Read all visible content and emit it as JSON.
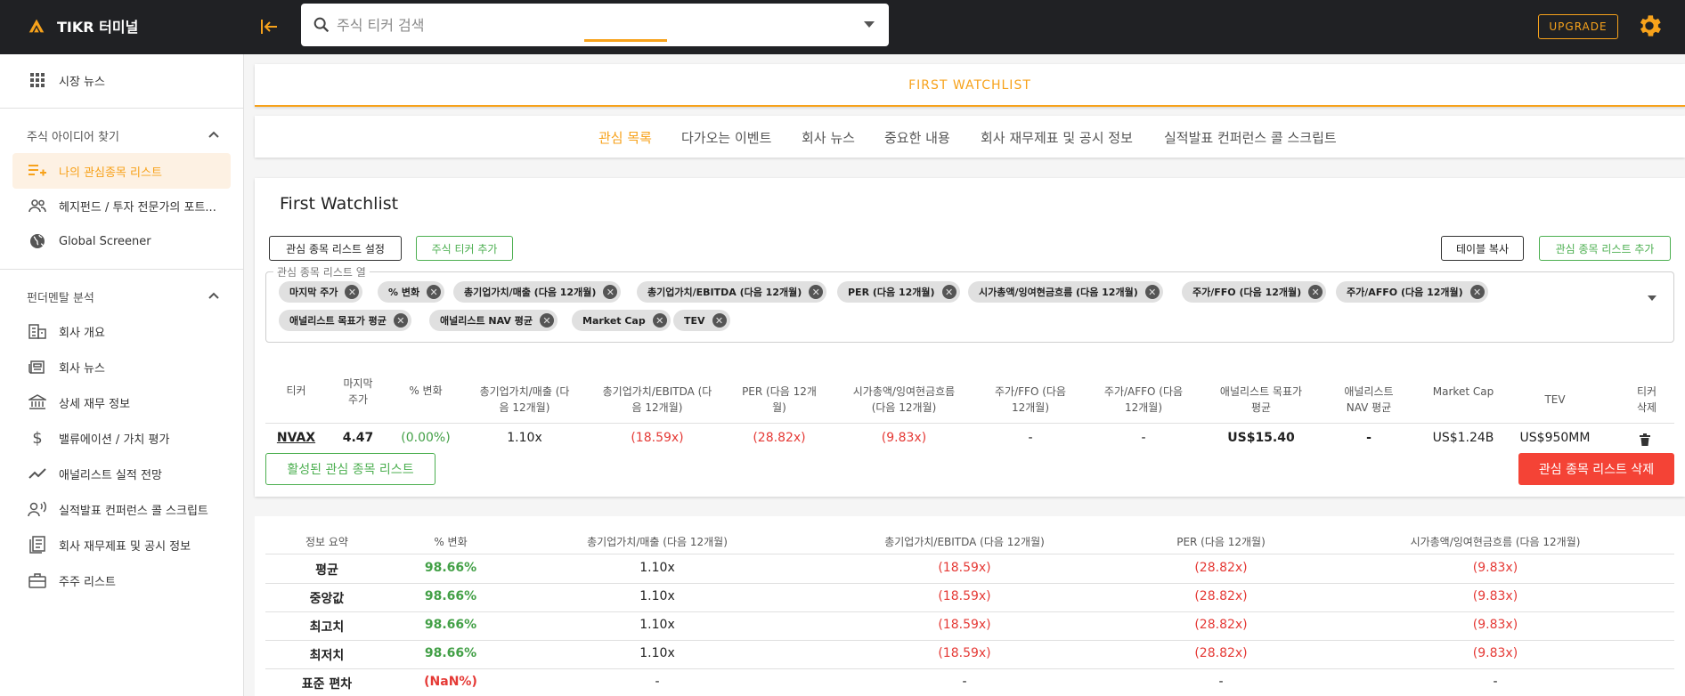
{
  "app": {
    "title": "TIKR 터미널",
    "search_placeholder": "주식 티커 검색",
    "upgrade_label": "UPGRADE"
  },
  "sidebar": {
    "market_news": "시장 뉴스",
    "section_ideas": "주식 아이디어 찾기",
    "ideas_items": [
      {
        "label": "나의 관심종목 리스트",
        "icon": "playlist-add-icon",
        "active": true
      },
      {
        "label": "헤지펀드 / 투자 전문가의 포트...",
        "icon": "people-icon"
      },
      {
        "label": "Global Screener",
        "icon": "globe-icon"
      }
    ],
    "section_fundamentals": "펀더멘탈 분석",
    "fund_items": [
      {
        "label": "회사 개요",
        "icon": "building-icon"
      },
      {
        "label": "회사 뉴스",
        "icon": "newspaper-icon"
      },
      {
        "label": "상세 재무 정보",
        "icon": "bank-icon"
      },
      {
        "label": "밸류에이션 / 가치 평가",
        "icon": "dollar-icon"
      },
      {
        "label": "애널리스트 실적 전망",
        "icon": "trend-icon"
      },
      {
        "label": "실적발표 컨퍼런스 콜 스크립트",
        "icon": "voice-icon"
      },
      {
        "label": "회사 재무제표 및 공시 정보",
        "icon": "document-icon"
      },
      {
        "label": "주주 리스트",
        "icon": "briefcase-icon"
      }
    ]
  },
  "watchlist": {
    "header": "FIRST WATCHLIST",
    "title": "First Watchlist",
    "tabs": [
      "관심 목록",
      "다가오는 이벤트",
      "회사 뉴스",
      "중요한 내용",
      "회사 재무제표 및 공시 정보",
      "실적발표 컨퍼런스 콜 스크립트"
    ],
    "settings_button": "관심 종목 리스트 설정",
    "add_ticker_button": "주식 티커 추가",
    "copy_table_button": "테이블 복사",
    "add_watchlist_button": "관심 종목 리스트 추가",
    "columns_legend": "관심 종목 리스트 열",
    "column_chips": [
      "마지막 주가",
      "% 변화",
      "총기업가치/매출 (다음 12개월)",
      "총기업가치/EBITDA (다음 12개월)",
      "PER (다음 12개월)",
      "시가총액/잉여현금흐름 (다음 12개월)",
      "주가/FFO (다음 12개월)",
      "주가/AFFO (다음 12개월)",
      "애널리스트 목표가 평균",
      "애널리스트 NAV 평균",
      "Market Cap",
      "TEV"
    ],
    "table_headers": {
      "ticker": "티커",
      "last_price": [
        "마지막",
        "주가"
      ],
      "pct_change": "% 변화",
      "ev_sales": [
        "총기업가치/매출 (다",
        "음 12개월)"
      ],
      "ev_ebitda": [
        "총기업가치/EBITDA (다",
        "음 12개월)"
      ],
      "per": [
        "PER (다음 12개",
        "월)"
      ],
      "mcap_fcf": [
        "시가총액/잉여현금흐름",
        "(다음 12개월)"
      ],
      "p_ffo": [
        "주가/FFO (다음",
        "12개월)"
      ],
      "p_affo": [
        "주가/AFFO (다음",
        "12개월)"
      ],
      "target": [
        "애널리스트 목표가",
        "평균"
      ],
      "nav": [
        "애널리스트",
        "NAV 평균"
      ],
      "mcap": "Market Cap",
      "tev": "TEV",
      "delete": [
        "티커",
        "삭제"
      ]
    },
    "row": {
      "ticker": "NVAX",
      "last_price": "4.47",
      "pct_change": "(0.00%)",
      "ev_sales": "1.10x",
      "ev_ebitda": "(18.59x)",
      "per": "(28.82x)",
      "mcap_fcf": "(9.83x)",
      "p_ffo": "-",
      "p_affo": "-",
      "target": "US$15.40",
      "nav": "-",
      "mcap": "US$1.24B",
      "tev": "US$950MM"
    },
    "active_lists_button": "활성된 관심 종목 리스트",
    "delete_list_button": "관심 종목 리스트 삭제"
  },
  "summary": {
    "headers": [
      "정보 요약",
      "% 변화",
      "총기업가치/매출 (다음 12개월)",
      "총기업가치/EBITDA (다음 12개월)",
      "PER (다음 12개월)",
      "시가총액/잉여현금흐름 (다음 12개월)"
    ],
    "rows": [
      {
        "label": "평균",
        "pct": "98.66%",
        "ev_sales": "1.10x",
        "ev_ebitda": "(18.59x)",
        "per": "(28.82x)",
        "mcap_fcf": "(9.83x)"
      },
      {
        "label": "중앙값",
        "pct": "98.66%",
        "ev_sales": "1.10x",
        "ev_ebitda": "(18.59x)",
        "per": "(28.82x)",
        "mcap_fcf": "(9.83x)"
      },
      {
        "label": "최고치",
        "pct": "98.66%",
        "ev_sales": "1.10x",
        "ev_ebitda": "(18.59x)",
        "per": "(28.82x)",
        "mcap_fcf": "(9.83x)"
      },
      {
        "label": "최저치",
        "pct": "98.66%",
        "ev_sales": "1.10x",
        "ev_ebitda": "(18.59x)",
        "per": "(28.82x)",
        "mcap_fcf": "(9.83x)"
      },
      {
        "label": "표준 편차",
        "pct": "(NaN%)",
        "ev_sales": "-",
        "ev_ebitda": "-",
        "per": "-",
        "mcap_fcf": "-"
      }
    ]
  },
  "colors": {
    "accent": "#f7a21b",
    "positive": "#43a047",
    "negative": "#e53935",
    "topbar": "#202124"
  }
}
